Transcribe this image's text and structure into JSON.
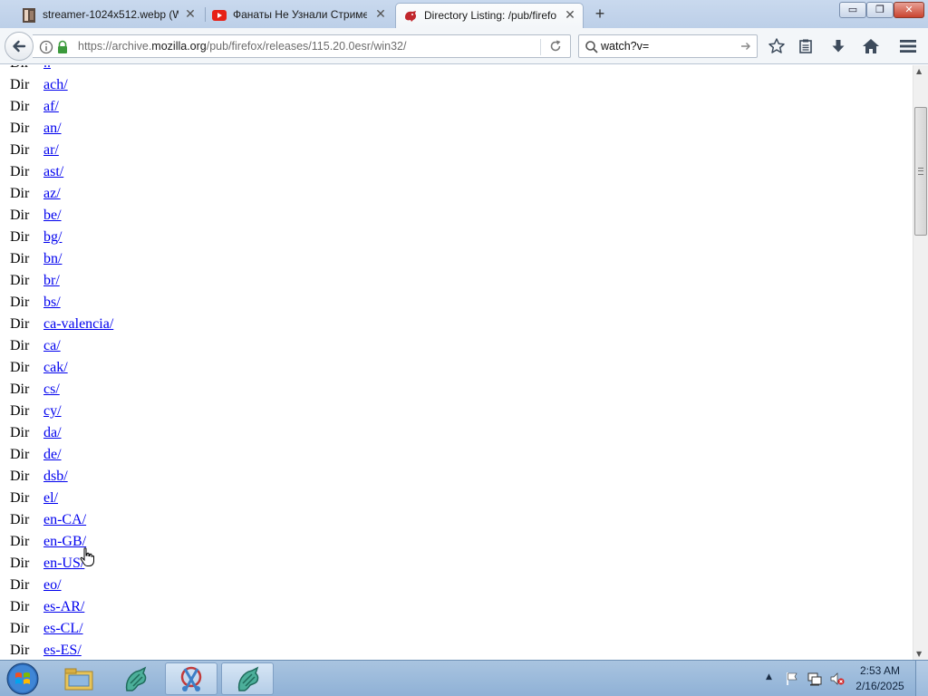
{
  "browser": {
    "tabs": [
      {
        "title": "streamer-1024x512.webp (W",
        "favicon": "image-thumbnail-icon",
        "active": false
      },
      {
        "title": "Фанаты Не Узнали Стриме",
        "favicon": "youtube-icon",
        "active": false
      },
      {
        "title": "Directory Listing: /pub/firefo",
        "favicon": "mozilla-dino-icon",
        "active": true
      }
    ],
    "new_tab_label": "+",
    "window_controls": {
      "minimize": "▭",
      "restore": "❐",
      "close": "✕"
    },
    "url": {
      "prefix": "https://archive.",
      "domain": "mozilla.org",
      "path": "/pub/firefox/releases/115.20.0esr/win32/"
    },
    "search": {
      "value": "watch?v="
    }
  },
  "listing": {
    "rows": [
      {
        "type": "Dir",
        "name": ".."
      },
      {
        "type": "Dir",
        "name": "ach/"
      },
      {
        "type": "Dir",
        "name": "af/"
      },
      {
        "type": "Dir",
        "name": "an/"
      },
      {
        "type": "Dir",
        "name": "ar/"
      },
      {
        "type": "Dir",
        "name": "ast/"
      },
      {
        "type": "Dir",
        "name": "az/"
      },
      {
        "type": "Dir",
        "name": "be/"
      },
      {
        "type": "Dir",
        "name": "bg/"
      },
      {
        "type": "Dir",
        "name": "bn/"
      },
      {
        "type": "Dir",
        "name": "br/"
      },
      {
        "type": "Dir",
        "name": "bs/"
      },
      {
        "type": "Dir",
        "name": "ca-valencia/"
      },
      {
        "type": "Dir",
        "name": "ca/"
      },
      {
        "type": "Dir",
        "name": "cak/"
      },
      {
        "type": "Dir",
        "name": "cs/"
      },
      {
        "type": "Dir",
        "name": "cy/"
      },
      {
        "type": "Dir",
        "name": "da/"
      },
      {
        "type": "Dir",
        "name": "de/"
      },
      {
        "type": "Dir",
        "name": "dsb/"
      },
      {
        "type": "Dir",
        "name": "el/"
      },
      {
        "type": "Dir",
        "name": "en-CA/"
      },
      {
        "type": "Dir",
        "name": "en-GB/"
      },
      {
        "type": "Dir",
        "name": "en-US/"
      },
      {
        "type": "Dir",
        "name": "eo/"
      },
      {
        "type": "Dir",
        "name": "es-AR/"
      },
      {
        "type": "Dir",
        "name": "es-CL/"
      },
      {
        "type": "Dir",
        "name": "es-ES/"
      }
    ]
  },
  "taskbar": {
    "start_icon": "windows-start-orb-icon",
    "pinned": [
      {
        "icon": "file-explorer-icon",
        "active": false
      },
      {
        "icon": "app-dragon-green-icon",
        "active": false
      },
      {
        "icon": "app-scissors-icon",
        "active": true
      },
      {
        "icon": "app-dragon-green-icon",
        "active": true
      }
    ],
    "tray_expand": "▲",
    "clock": {
      "time": "2:53 AM",
      "date": "2/16/2025"
    }
  },
  "colors": {
    "link": "#0000ee",
    "tabstrip": "#bccfe8",
    "taskbar": "#8fb1d6"
  }
}
